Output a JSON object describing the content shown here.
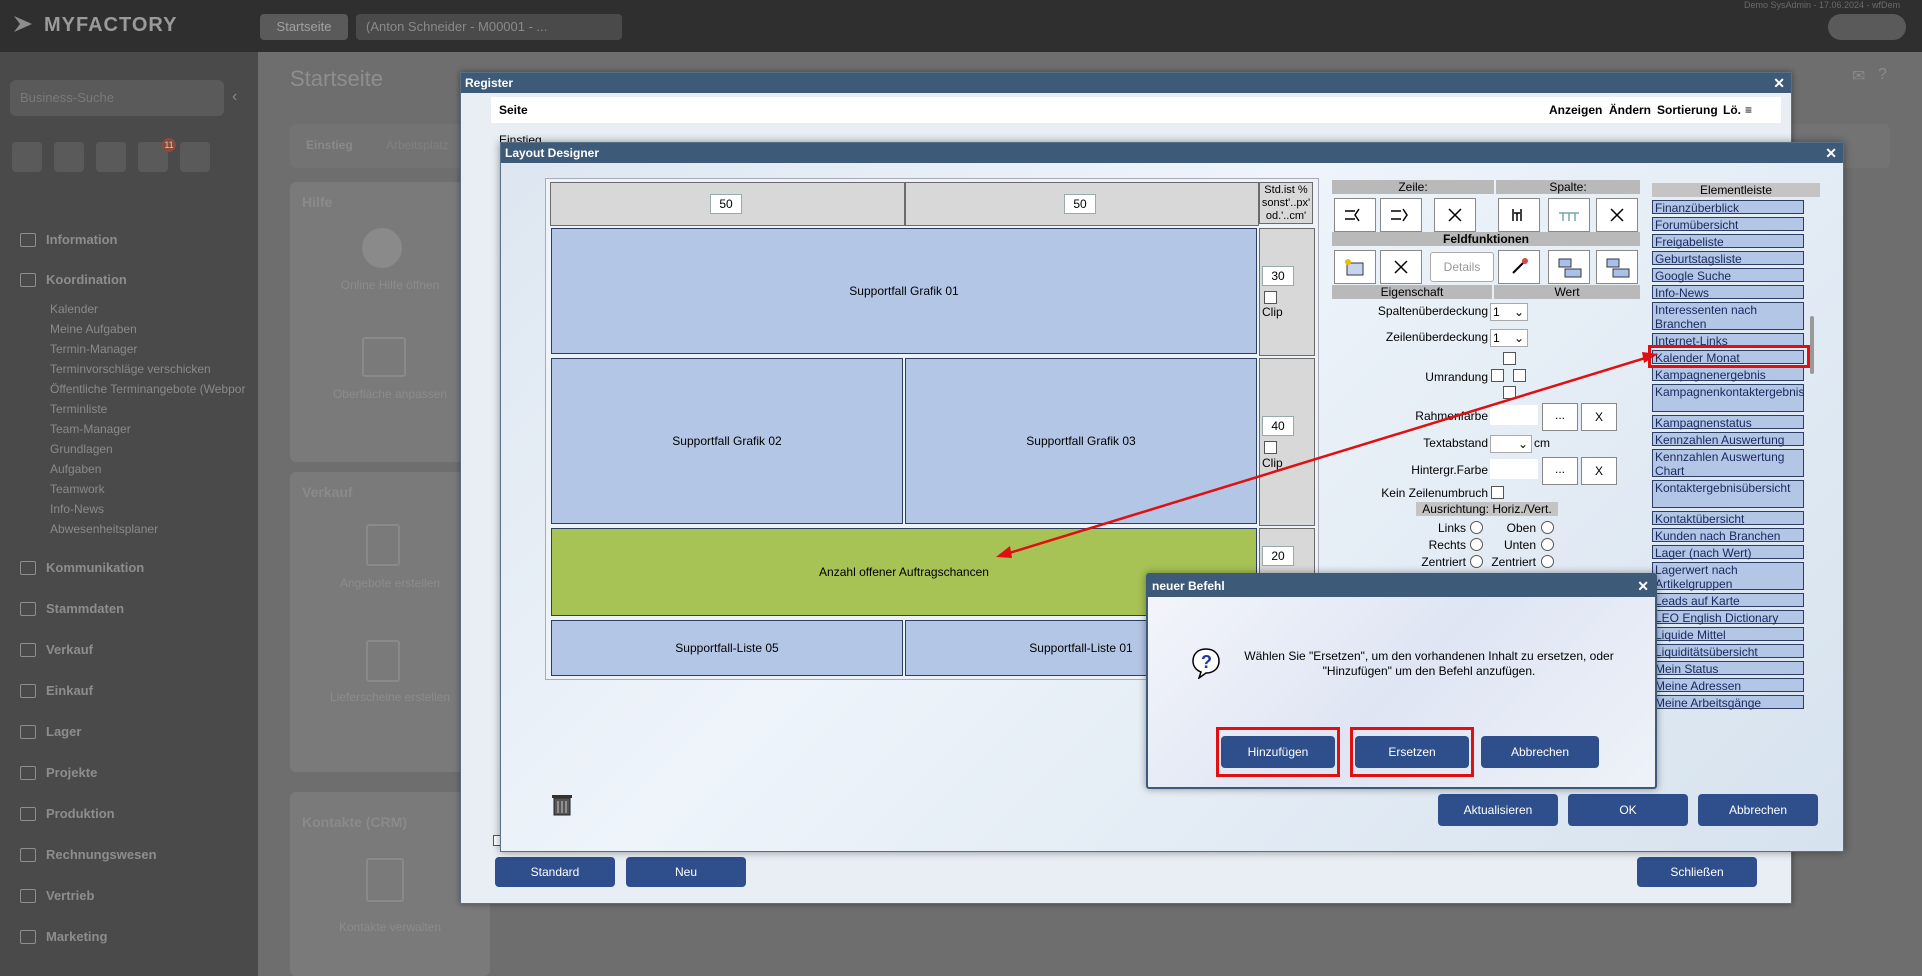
{
  "app": {
    "logo": "MYFACTORY",
    "top_tab": "Startseite",
    "top_record": "(Anton Schneider - M00001 - ...",
    "user_info": "Demo SysAdmin - 17.06.2024 - wfDem",
    "search_placeholder": "Business-Suche",
    "badge_count": "11",
    "page_title": "Startseite",
    "content_tabs": [
      "Einstieg",
      "Arbeitsplatz"
    ],
    "sidebar": {
      "sections": [
        "Information",
        "Koordination",
        "Kommunikation",
        "Stammdaten",
        "Verkauf",
        "Einkauf",
        "Lager",
        "Projekte",
        "Produktion",
        "Rechnungswesen",
        "Vertrieb",
        "Marketing"
      ],
      "sub_items": [
        "Kalender",
        "Meine Aufgaben",
        "Termin-Manager",
        "Terminvorschläge verschicken",
        "Öffentliche Terminangebote (Webpor",
        "Terminliste",
        "Team-Manager"
      ],
      "folder_items": [
        "Grundlagen",
        "Aufgaben",
        "Teamwork",
        "Info-News",
        "Abwesenheitsplaner"
      ]
    },
    "groups": {
      "hilfe": "Hilfe",
      "hilfe_items": [
        "Online Hilfe öffnen",
        "Oberfläche anpassen"
      ],
      "verkauf": "Verkauf",
      "verkauf_items": [
        "Angebote erstellen",
        "Lieferscheine erstellen"
      ],
      "kontakte": "Kontakte (CRM)",
      "kontakte_items": [
        "Kontakte verwalten"
      ]
    }
  },
  "register": {
    "title": "Register",
    "col_seite": "Seite",
    "col_anzeigen": "Anzeigen",
    "col_aendern": "Ändern",
    "col_sortierung": "Sortierung",
    "col_loeschen": "Lö.",
    "row1": "Einstieg",
    "btn_standard": "Standard",
    "btn_neu": "Neu",
    "btn_schliessen": "Schließen"
  },
  "layout": {
    "title": "Layout Designer",
    "col_width_1": "50",
    "col_width_2": "50",
    "std_note": "Std.ist % sonst'..px' od.'..cm'",
    "row_heights": [
      "30",
      "40",
      "20"
    ],
    "clip_label": "Clip",
    "cells": {
      "grafik01": "Supportfall Grafik 01",
      "grafik02": "Supportfall Grafik 02",
      "grafik03": "Supportfall Grafik 03",
      "auftragschancen": "Anzahl offener Auftragschancen",
      "liste05": "Supportfall-Liste 05",
      "liste01": "Supportfall-Liste 01"
    },
    "hdr_zeile": "Zeile:",
    "hdr_spalte": "Spalte:",
    "hdr_feldfunktionen": "Feldfunktionen",
    "btn_details": "Details",
    "hdr_eigenschaft": "Eigenschaft",
    "hdr_wert": "Wert",
    "prop_spalten": "Spaltenüberdeckung",
    "prop_spalten_val": "1",
    "prop_zeilen": "Zeilenüberdeckung",
    "prop_zeilen_val": "1",
    "prop_umrandung": "Umrandung",
    "prop_rahmen": "Rahmenfarbe",
    "prop_textabstand": "Textabstand",
    "unit_cm": "cm",
    "prop_hintergr": "Hintergr.Farbe",
    "btn_dots": "...",
    "btn_x": "X",
    "prop_kein_umbruch": "Kein Zeilenumbruch",
    "hdr_ausrichtung": "Ausrichtung: Horiz./Vert.",
    "align_links": "Links",
    "align_rechts": "Rechts",
    "align_zentriert": "Zentriert",
    "align_oben": "Oben",
    "align_unten": "Unten",
    "align_zentriert2": "Zentriert",
    "elementleiste": "Elementleiste",
    "elements": [
      "Finanzüberblick",
      "Forumübersicht",
      "Freigabeliste",
      "Geburtstagsliste",
      "Google Suche",
      "Info-News",
      "Interessenten nach Branchen",
      "Internet-Links",
      "Kalender Monat",
      "Kampagnenergebnis",
      "Kampagnenkontaktergebnis",
      "Kampagnenstatus",
      "Kennzahlen Auswertung",
      "Kennzahlen Auswertung Chart",
      "Kontaktergebnisübersicht",
      "Kontaktübersicht",
      "Kunden nach Branchen",
      "Lager (nach Wert)",
      "Lagerwert nach Artikelgruppen",
      "Leads auf Karte",
      "LEO English Dictionary",
      "Liquide Mittel",
      "Liquiditätsübersicht",
      "Mein Status",
      "Meine Adressen",
      "Meine Arbeitsgänge"
    ],
    "btn_aktualisieren": "Aktualisieren",
    "btn_ok": "OK",
    "btn_abbrechen": "Abbrechen"
  },
  "befehl": {
    "title": "neuer Befehl",
    "message": "Wählen Sie \"Ersetzen\", um den vorhandenen Inhalt zu ersetzen, oder \"Hinzufügen\" um den Befehl anzufügen.",
    "btn_hinzufuegen": "Hinzufügen",
    "btn_ersetzen": "Ersetzen",
    "btn_abbrechen": "Abbrechen"
  },
  "colors": {
    "cell_blue": "#b4c6e6",
    "cell_green": "#a7c255",
    "dialog_title": "#3d5a78",
    "button_blue": "#2e4e8c",
    "highlight_red": "#e01010"
  }
}
